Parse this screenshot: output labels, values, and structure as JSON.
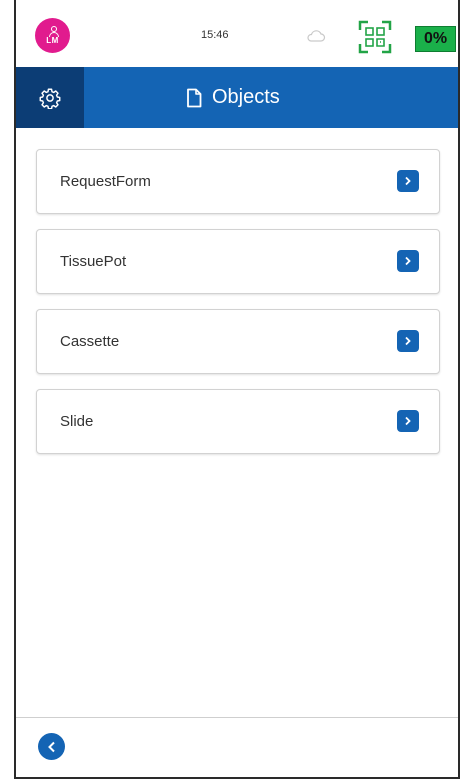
{
  "status_bar": {
    "avatar_initials": "LM",
    "time": "15:46",
    "battery_label": "0%"
  },
  "header": {
    "title": "Objects"
  },
  "objects": [
    {
      "label": "RequestForm"
    },
    {
      "label": "TissuePot"
    },
    {
      "label": "Cassette"
    },
    {
      "label": "Slide"
    }
  ],
  "colors": {
    "primary": "#1464b4",
    "settings_bg": "#0c3d75",
    "avatar": "#e11b8e",
    "battery": "#1ab04a"
  },
  "icons": {
    "settings": "gear-icon",
    "title": "document-icon",
    "row_action": "chevron-right-icon",
    "back": "chevron-left-icon",
    "status_cloud": "cloud-icon",
    "status_scanner": "qr-scan-icon"
  }
}
